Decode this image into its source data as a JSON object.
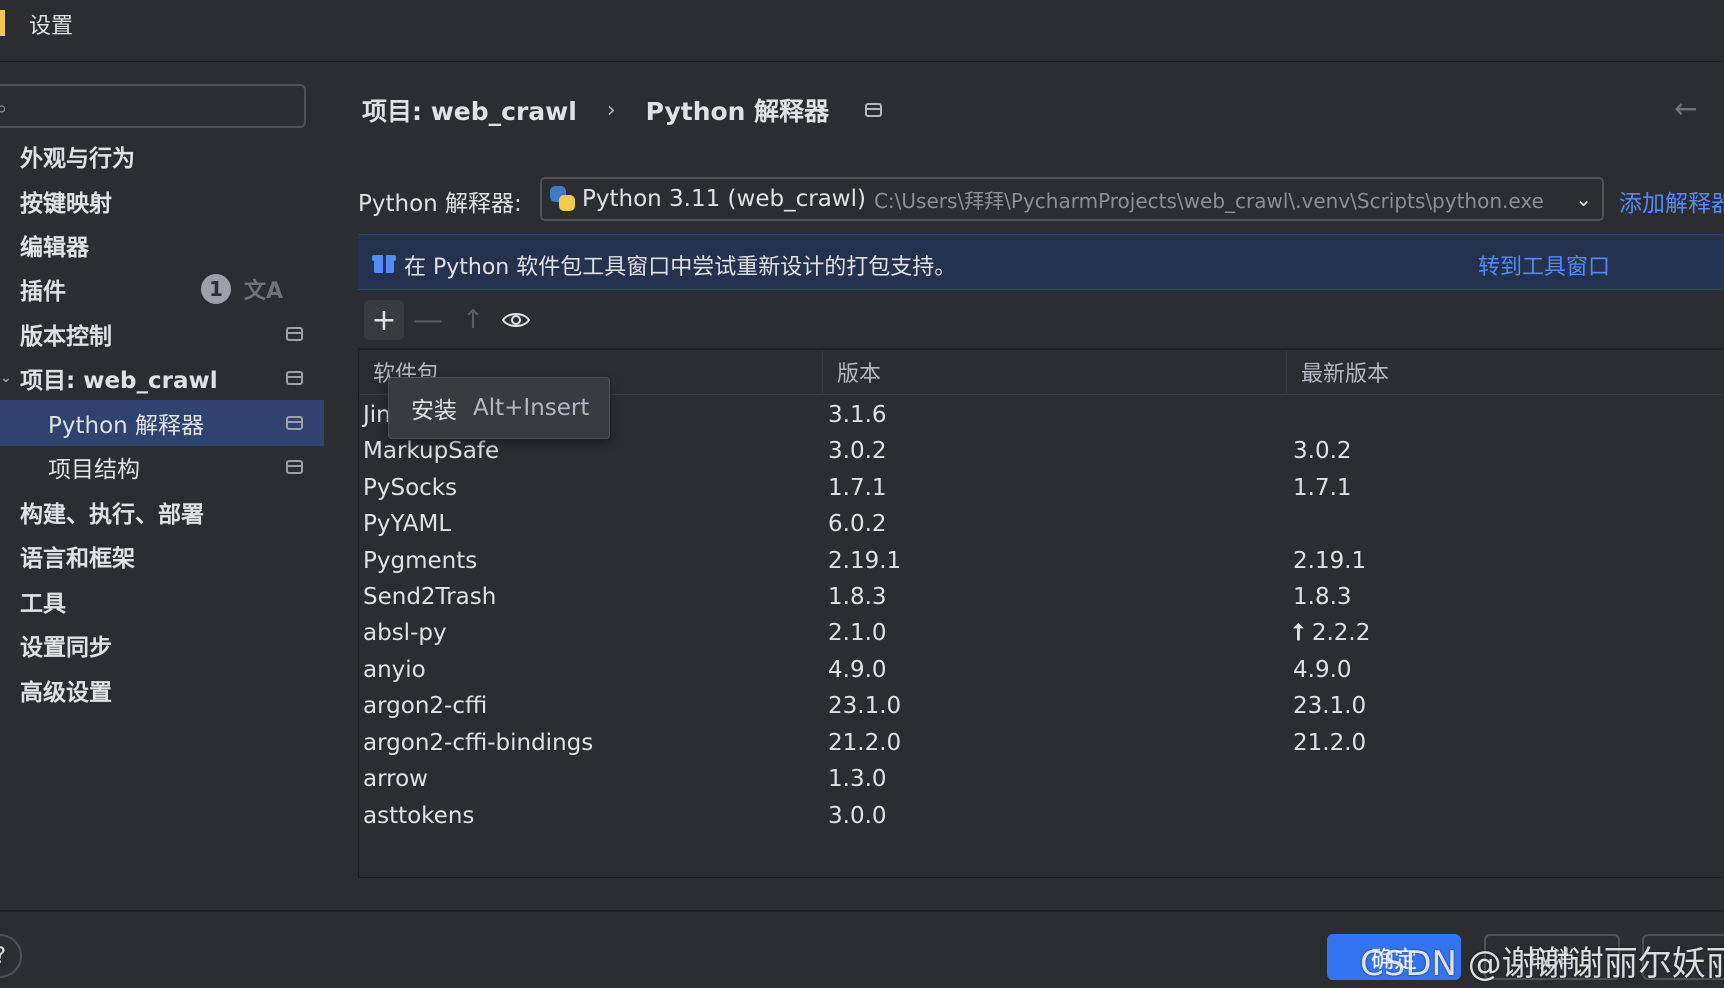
{
  "window": {
    "title": "设置"
  },
  "search": {
    "icon": "search-icon",
    "placeholder": ""
  },
  "sidebar": {
    "items": [
      {
        "label": "外观与行为"
      },
      {
        "label": "按键映射"
      },
      {
        "label": "编辑器"
      },
      {
        "label": "插件",
        "badge": "1"
      },
      {
        "label": "版本控制"
      },
      {
        "label": "项目: web_crawl"
      },
      {
        "label": "Python 解释器"
      },
      {
        "label": "项目结构"
      },
      {
        "label": "构建、执行、部署"
      },
      {
        "label": "语言和框架"
      },
      {
        "label": "工具"
      },
      {
        "label": "设置同步"
      },
      {
        "label": "高级设置"
      }
    ]
  },
  "breadcrumb": {
    "project": "项目: web_crawl",
    "separator": "›",
    "page": "Python 解释器"
  },
  "interpreter": {
    "label": "Python 解释器:",
    "name": "Python 3.11 (web_crawl)",
    "path": "C:\\Users\\拜拜\\PycharmProjects\\web_crawl\\.venv\\Scripts\\python.exe",
    "add_link": "添加解释器"
  },
  "banner": {
    "text": "在 Python 软件包工具窗口中尝试重新设计的打包支持。",
    "link": "转到工具窗口"
  },
  "toolbar": {
    "add": "+",
    "remove": "—",
    "upgrade": "↑",
    "show": "👁"
  },
  "tooltip": {
    "label": "安装",
    "shortcut": "Alt+Insert"
  },
  "table": {
    "columns": [
      "软件包",
      "版本",
      "最新版本"
    ],
    "rows": [
      {
        "name": "Jinja2",
        "version": "3.1.6",
        "latest": ""
      },
      {
        "name": "MarkupSafe",
        "version": "3.0.2",
        "latest": "3.0.2"
      },
      {
        "name": "PySocks",
        "version": "1.7.1",
        "latest": "1.7.1"
      },
      {
        "name": "PyYAML",
        "version": "6.0.2",
        "latest": ""
      },
      {
        "name": "Pygments",
        "version": "2.19.1",
        "latest": "2.19.1"
      },
      {
        "name": "Send2Trash",
        "version": "1.8.3",
        "latest": "1.8.3"
      },
      {
        "name": "absl-py",
        "version": "2.1.0",
        "latest": "2.2.2",
        "upgrade": true
      },
      {
        "name": "anyio",
        "version": "4.9.0",
        "latest": "4.9.0"
      },
      {
        "name": "argon2-cffi",
        "version": "23.1.0",
        "latest": "23.1.0"
      },
      {
        "name": "argon2-cffi-bindings",
        "version": "21.2.0",
        "latest": "21.2.0"
      },
      {
        "name": "arrow",
        "version": "1.3.0",
        "latest": ""
      },
      {
        "name": "asttokens",
        "version": "3.0.0",
        "latest": ""
      }
    ]
  },
  "footer": {
    "help": "?",
    "ok": "确定",
    "cancel": "取消",
    "apply": ""
  },
  "watermark": "CSDN @谢谢谢丽尔妖丽",
  "colors": {
    "accent": "#3574f0",
    "selection": "#2e436e",
    "link": "#548af7",
    "background": "#2b2d30"
  }
}
